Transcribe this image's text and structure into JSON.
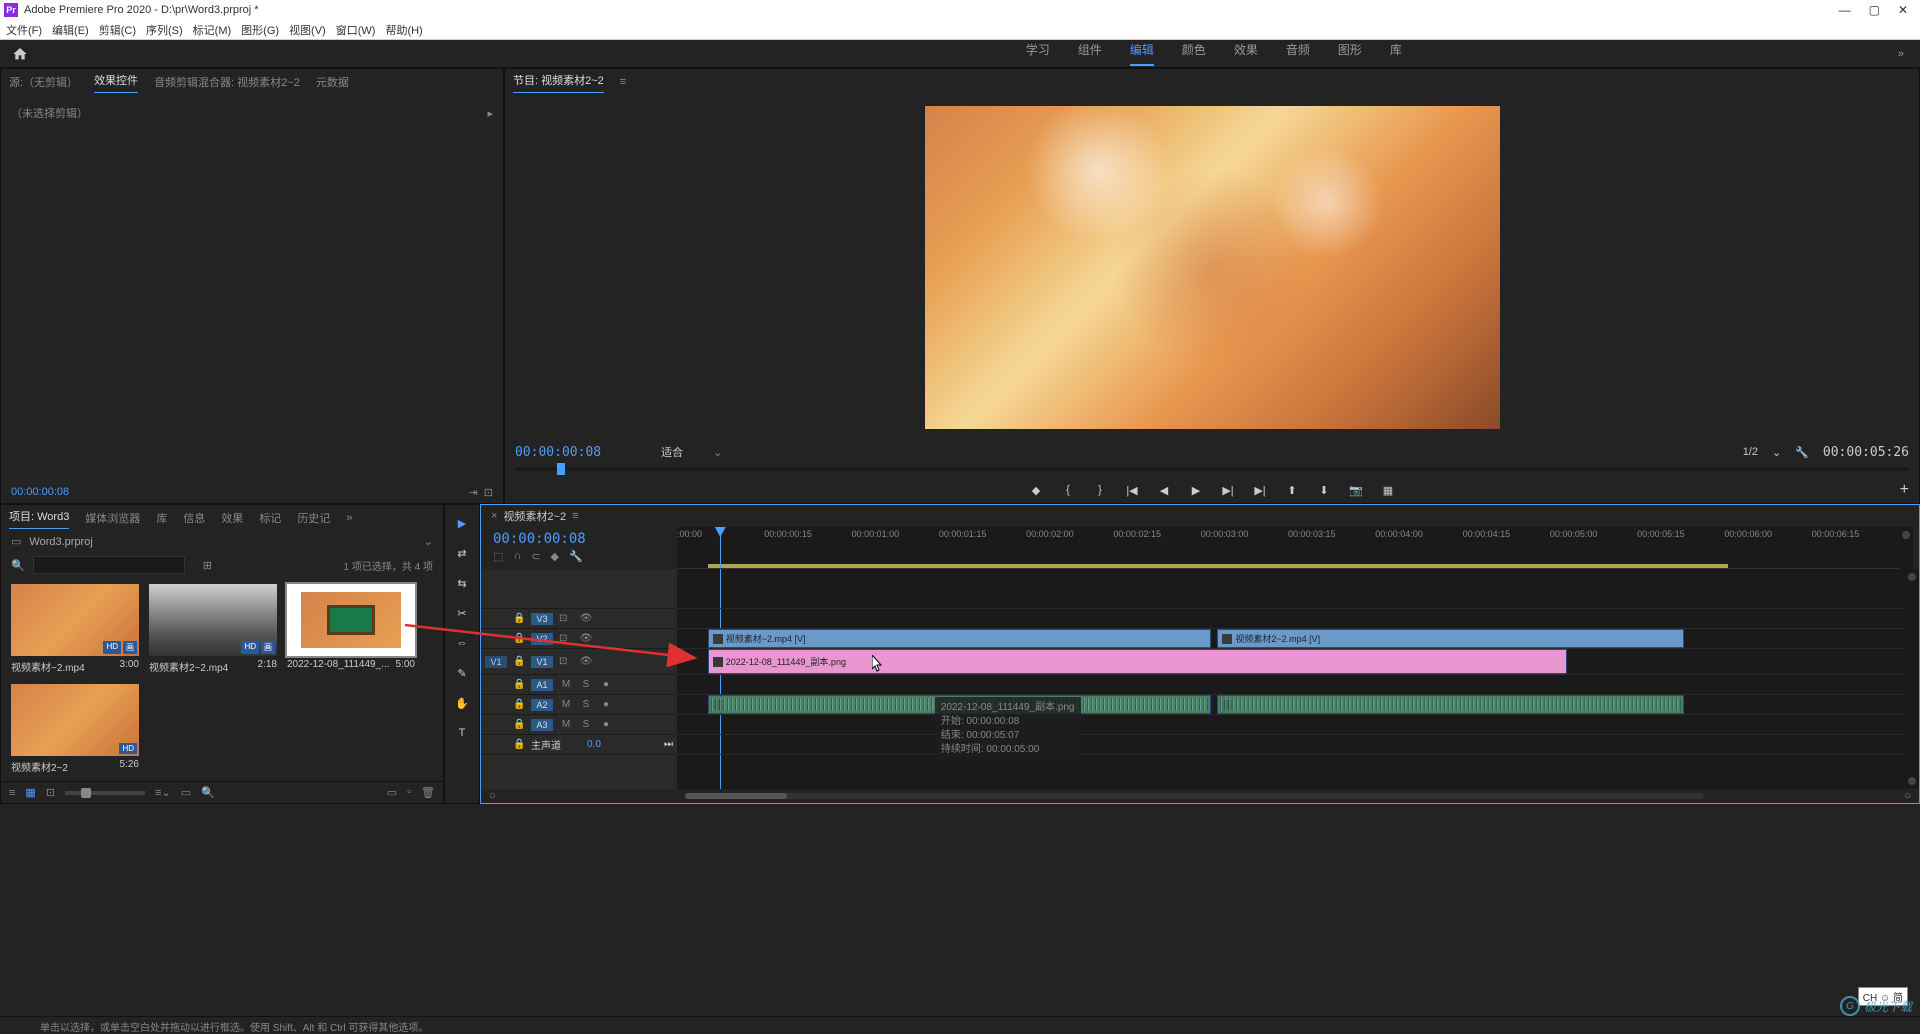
{
  "title_bar": {
    "app_icon": "Pr",
    "title": "Adobe Premiere Pro 2020 - D:\\pr\\Word3.prproj *"
  },
  "menu_bar": {
    "items": [
      "文件(F)",
      "编辑(E)",
      "剪辑(C)",
      "序列(S)",
      "标记(M)",
      "图形(G)",
      "视图(V)",
      "窗口(W)",
      "帮助(H)"
    ]
  },
  "workspace_bar": {
    "items": [
      "学习",
      "组件",
      "编辑",
      "颜色",
      "效果",
      "音频",
      "图形",
      "库"
    ],
    "active_index": 2,
    "overflow": "»"
  },
  "effect_controls_panel": {
    "tabs": [
      "源:（无剪辑）",
      "效果控件",
      "音频剪辑混合器: 视频素材2~2",
      "元数据"
    ],
    "active_tab_index": 1,
    "no_clip_text": "（未选择剪辑）",
    "timecode": "00:00:00:08"
  },
  "program_monitor": {
    "tab_label": "节目: 视频素材2~2",
    "timecode": "00:00:00:08",
    "fit_label": "适合",
    "scale_label": "1/2",
    "duration": "00:00:05:26"
  },
  "project_panel": {
    "tabs": [
      "项目: Word3",
      "媒体浏览器",
      "库",
      "信息",
      "效果",
      "标记",
      "历史记",
      "»"
    ],
    "active_tab_index": 0,
    "bin_name": "Word3.prproj",
    "search_placeholder": "",
    "selection_info": "1 项已选择，共 4 项",
    "items": [
      {
        "name": "视频素材~2.mp4",
        "duration": "3:00",
        "badges": [
          "HD",
          "画"
        ]
      },
      {
        "name": "视频素材2~2.mp4",
        "duration": "2:18",
        "badges": [
          "HD",
          "画"
        ]
      },
      {
        "name": "2022-12-08_111449_...",
        "duration": "5:00",
        "badges": []
      },
      {
        "name": "视频素材2~2",
        "duration": "5:26",
        "badges": [
          "HD"
        ]
      }
    ]
  },
  "timeline_panel": {
    "sequence_name": "视频素材2~2",
    "timecode": "00:00:00:08",
    "ruler_ticks": [
      ":00:00",
      "00:00:00:15",
      "00:00:01:00",
      "00:00:01:15",
      "00:00:02:00",
      "00:00:02:15",
      "00:00:03:00",
      "00:00:03:15",
      "00:00:04:00",
      "00:00:04:15",
      "00:00:05:00",
      "00:00:05:15",
      "00:00:06:00",
      "00:00:06:15"
    ],
    "tracks": {
      "v3": "V3",
      "v2": "V2",
      "v1_src": "V1",
      "v1": "V1",
      "a1": "A1",
      "a2": "A2",
      "a3": "A3",
      "master": "主声道",
      "master_val": "0.0"
    },
    "clips": {
      "v2_a": "视频素材~2.mp4 [V]",
      "v2_b": "视频素材2~2.mp4 [V]",
      "v1": "2022-12-08_111449_副本.png",
      "a1_a": "",
      "a1_b": ""
    },
    "tooltip": {
      "line1": "2022-12-08_111449_副本.png",
      "line2": "开始: 00:00:00:08",
      "line3": "结束: 00:00:05:07",
      "line4": "持续时间: 00:00:05:00"
    }
  },
  "status_bar": {
    "text": "单击以选择，或单击空白处并拖动以进行框选。使用 Shift、Alt 和 Ctrl 可获得其他选项。"
  },
  "watermark": {
    "text": "极光下载"
  },
  "ime": {
    "text": "CH ☺ 简"
  }
}
